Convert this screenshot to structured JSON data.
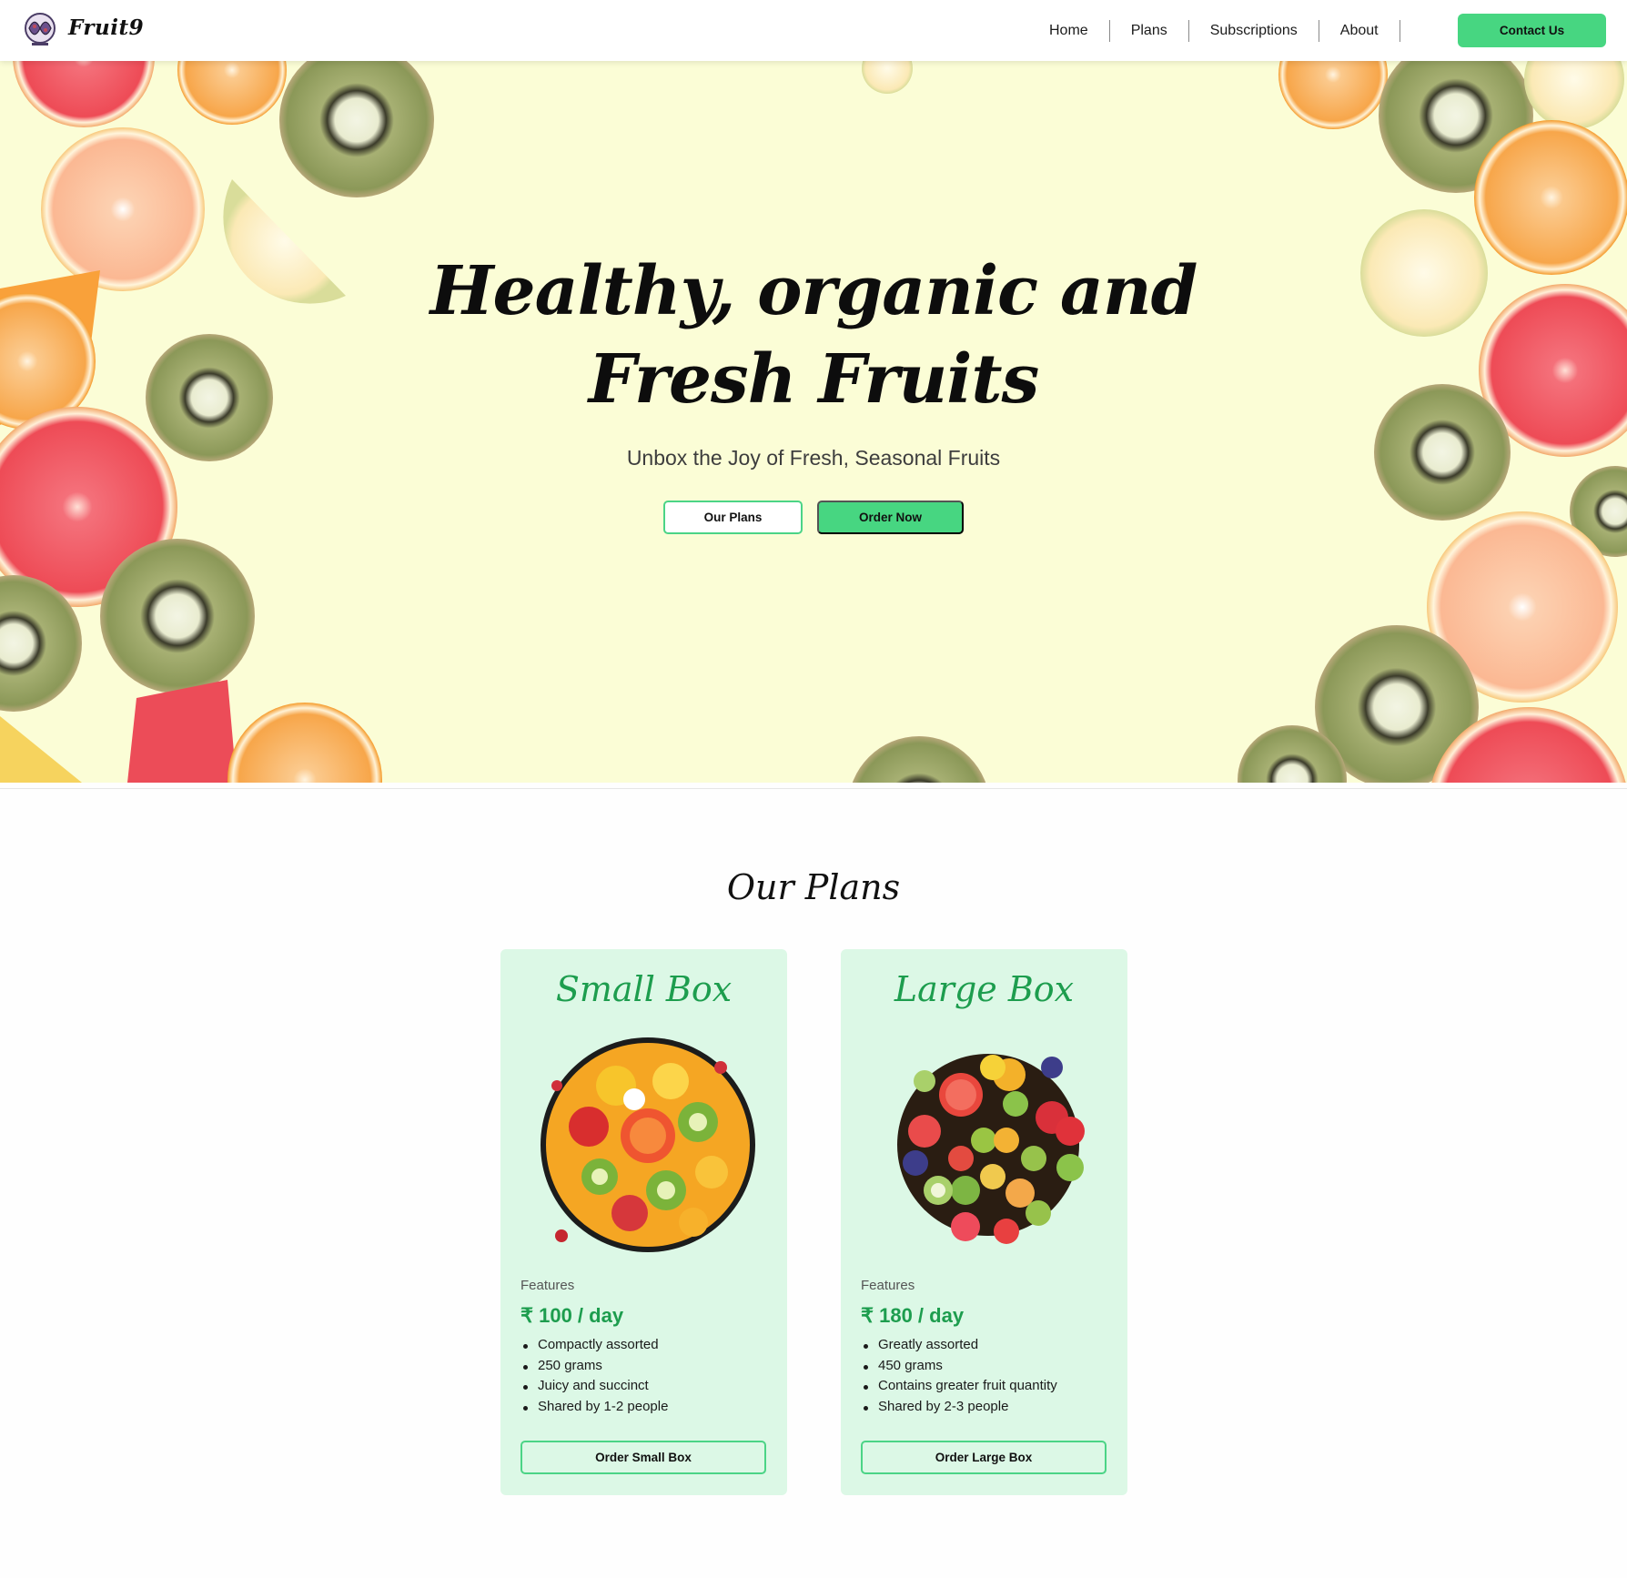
{
  "brand": {
    "name": "Fruit9",
    "logo_icon": "fruit-logo-icon",
    "accent": "#47d681",
    "plan_color": "#1d9d4e"
  },
  "nav": {
    "items": [
      {
        "label": "Home"
      },
      {
        "label": "Plans"
      },
      {
        "label": "Subscriptions"
      },
      {
        "label": "About"
      }
    ],
    "contact_label": "Contact Us"
  },
  "hero": {
    "title_line1": "Healthy, organic and",
    "title_line2": "Fresh Fruits",
    "subtitle": "Unbox the Joy of Fresh, Seasonal Fruits",
    "primary_label": "Order Now",
    "secondary_label": "Our Plans",
    "background": "#fbfdd6"
  },
  "plans": {
    "title": "Our Plans",
    "cards": [
      {
        "title": "Small Box",
        "image_icon": "fruit-bowl-small-image",
        "features_label": "Features",
        "price": "₹ 100 / day",
        "features": [
          "Compactly assorted",
          "250 grams",
          "Juicy and succinct",
          "Shared by 1-2 people"
        ],
        "button_label": "Order Small Box"
      },
      {
        "title": "Large Box",
        "image_icon": "fruit-bowl-large-image",
        "features_label": "Features",
        "price": "₹ 180 / day",
        "features": [
          "Greatly assorted",
          "450 grams",
          "Contains greater fruit quantity",
          "Shared by 2-3 people"
        ],
        "button_label": "Order Large Box"
      }
    ]
  }
}
